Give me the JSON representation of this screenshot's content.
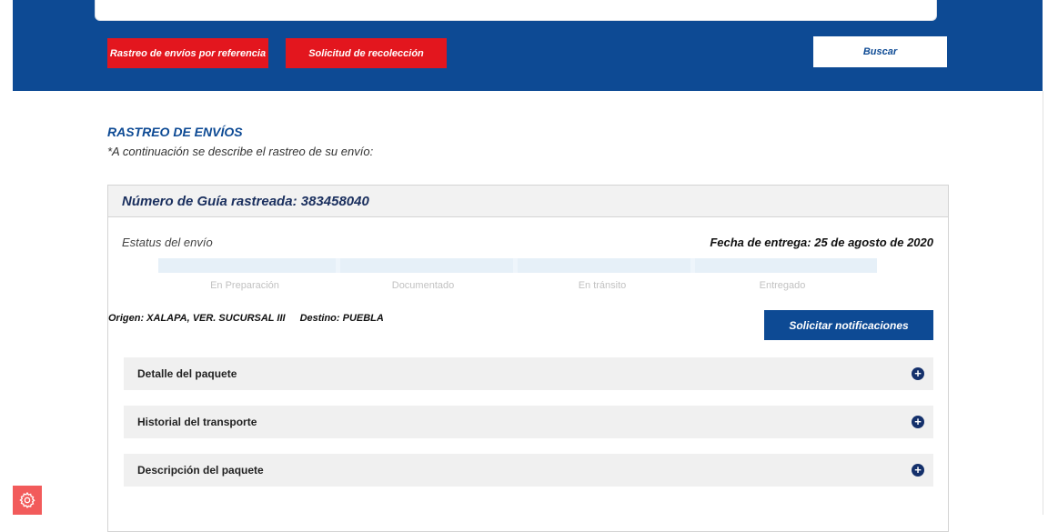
{
  "header": {
    "btn_referencia": "Rastreo de envíos por referencia",
    "btn_recoleccion": "Solicitud de recolección",
    "btn_buscar": "Buscar"
  },
  "section": {
    "title": "RASTREO DE ENVÍOS",
    "subtitle": "*A continuación se describe el rastreo de su envío:"
  },
  "card": {
    "guia": "Número de Guía rastreada: 383458040",
    "estatus_label": "Estatus del envío",
    "fecha_entrega": "Fecha de entrega: 25 de agosto de 2020",
    "steps": [
      "En Preparación",
      "Documentado",
      "En tránsito",
      "Entregado"
    ],
    "origen": "Origen: XALAPA, VER. SUCURSAL III",
    "destino": "Destino: PUEBLA",
    "notif_btn": "Solicitar notificaciones",
    "accordions": [
      "Detalle del paquete",
      "Historial del transporte",
      "Descripción del paquete"
    ]
  },
  "colors": {
    "brand_blue": "#0d4a94",
    "brand_red": "#e3161e",
    "settings_red": "#f25b5b"
  },
  "icons": {
    "accordion_toggle": "plus-circle-icon",
    "settings": "gear-icon"
  }
}
